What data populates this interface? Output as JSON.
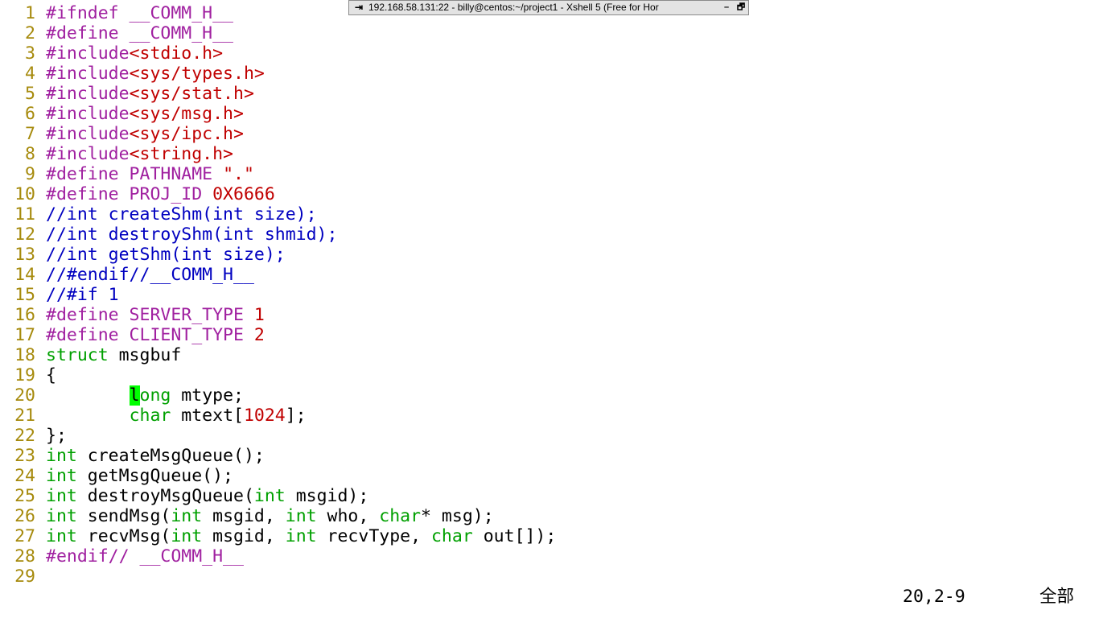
{
  "titlebar": {
    "text": "192.168.58.131:22 - billy@centos:~/project1 - Xshell 5 (Free for Hor",
    "pin_glyph": "⇥",
    "minimize_glyph": "–",
    "restore_glyph": "🗗"
  },
  "colors": {
    "background": "#ffffff",
    "line_number": "#a68a0c",
    "preproc": "#a020a0",
    "string": "#c00000",
    "number": "#c00000",
    "comment": "#0000c0",
    "type": "#00a000",
    "cursor_bg": "#00ff00",
    "normal": "#000000"
  },
  "editor": {
    "lines": [
      {
        "n": "1",
        "tokens": [
          {
            "t": "#ifndef __COMM_H__",
            "c": "preproc"
          }
        ]
      },
      {
        "n": "2",
        "tokens": [
          {
            "t": "#define __COMM_H__",
            "c": "preproc"
          }
        ]
      },
      {
        "n": "3",
        "tokens": [
          {
            "t": "#include",
            "c": "preproc"
          },
          {
            "t": "<stdio.h>",
            "c": "string"
          }
        ]
      },
      {
        "n": "4",
        "tokens": [
          {
            "t": "#include",
            "c": "preproc"
          },
          {
            "t": "<sys/types.h>",
            "c": "string"
          }
        ]
      },
      {
        "n": "5",
        "tokens": [
          {
            "t": "#include",
            "c": "preproc"
          },
          {
            "t": "<sys/stat.h>",
            "c": "string"
          }
        ]
      },
      {
        "n": "6",
        "tokens": [
          {
            "t": "#include",
            "c": "preproc"
          },
          {
            "t": "<sys/msg.h>",
            "c": "string"
          }
        ]
      },
      {
        "n": "7",
        "tokens": [
          {
            "t": "#include",
            "c": "preproc"
          },
          {
            "t": "<sys/ipc.h>",
            "c": "string"
          }
        ]
      },
      {
        "n": "8",
        "tokens": [
          {
            "t": "#include",
            "c": "preproc"
          },
          {
            "t": "<string.h>",
            "c": "string"
          }
        ]
      },
      {
        "n": "9",
        "tokens": [
          {
            "t": "#define PATHNAME ",
            "c": "preproc"
          },
          {
            "t": "\".\"",
            "c": "string"
          }
        ]
      },
      {
        "n": "10",
        "tokens": [
          {
            "t": "#define PROJ_ID ",
            "c": "preproc"
          },
          {
            "t": "0X6666",
            "c": "number"
          }
        ]
      },
      {
        "n": "11",
        "tokens": [
          {
            "t": "//int createShm(int size);",
            "c": "comment"
          }
        ]
      },
      {
        "n": "12",
        "tokens": [
          {
            "t": "//int destroyShm(int shmid);",
            "c": "comment"
          }
        ]
      },
      {
        "n": "13",
        "tokens": [
          {
            "t": "//int getShm(int size);",
            "c": "comment"
          }
        ]
      },
      {
        "n": "14",
        "tokens": [
          {
            "t": "//#endif//__COMM_H__",
            "c": "comment"
          }
        ]
      },
      {
        "n": "15",
        "tokens": [
          {
            "t": "//#if 1",
            "c": "comment"
          }
        ]
      },
      {
        "n": "16",
        "tokens": [
          {
            "t": "#define SERVER_TYPE ",
            "c": "preproc"
          },
          {
            "t": "1",
            "c": "number"
          }
        ]
      },
      {
        "n": "17",
        "tokens": [
          {
            "t": "#define CLIENT_TYPE ",
            "c": "preproc"
          },
          {
            "t": "2",
            "c": "number"
          }
        ]
      },
      {
        "n": "18",
        "tokens": [
          {
            "t": "struct",
            "c": "type"
          },
          {
            "t": " msgbuf",
            "c": "normal"
          }
        ]
      },
      {
        "n": "19",
        "tokens": [
          {
            "t": "{",
            "c": "normal"
          }
        ]
      },
      {
        "n": "20",
        "tokens": [
          {
            "t": "        ",
            "c": "normal"
          },
          {
            "t": "l",
            "c": "cursor"
          },
          {
            "t": "ong",
            "c": "type"
          },
          {
            "t": " mtype;",
            "c": "normal"
          }
        ]
      },
      {
        "n": "21",
        "tokens": [
          {
            "t": "        ",
            "c": "normal"
          },
          {
            "t": "char",
            "c": "type"
          },
          {
            "t": " mtext[",
            "c": "normal"
          },
          {
            "t": "1024",
            "c": "number"
          },
          {
            "t": "];",
            "c": "normal"
          }
        ]
      },
      {
        "n": "22",
        "tokens": [
          {
            "t": "};",
            "c": "normal"
          }
        ]
      },
      {
        "n": "23",
        "tokens": [
          {
            "t": "int",
            "c": "type"
          },
          {
            "t": " createMsgQueue();",
            "c": "normal"
          }
        ]
      },
      {
        "n": "24",
        "tokens": [
          {
            "t": "int",
            "c": "type"
          },
          {
            "t": " getMsgQueue();",
            "c": "normal"
          }
        ]
      },
      {
        "n": "25",
        "tokens": [
          {
            "t": "int",
            "c": "type"
          },
          {
            "t": " destroyMsgQueue(",
            "c": "normal"
          },
          {
            "t": "int",
            "c": "type"
          },
          {
            "t": " msgid);",
            "c": "normal"
          }
        ]
      },
      {
        "n": "26",
        "tokens": [
          {
            "t": "int",
            "c": "type"
          },
          {
            "t": " sendMsg(",
            "c": "normal"
          },
          {
            "t": "int",
            "c": "type"
          },
          {
            "t": " msgid, ",
            "c": "normal"
          },
          {
            "t": "int",
            "c": "type"
          },
          {
            "t": " who, ",
            "c": "normal"
          },
          {
            "t": "char",
            "c": "type"
          },
          {
            "t": "* msg);",
            "c": "normal"
          }
        ]
      },
      {
        "n": "27",
        "tokens": [
          {
            "t": "int",
            "c": "type"
          },
          {
            "t": " recvMsg(",
            "c": "normal"
          },
          {
            "t": "int",
            "c": "type"
          },
          {
            "t": " msgid, ",
            "c": "normal"
          },
          {
            "t": "int",
            "c": "type"
          },
          {
            "t": " recvType, ",
            "c": "normal"
          },
          {
            "t": "char",
            "c": "type"
          },
          {
            "t": " out[]);",
            "c": "normal"
          }
        ]
      },
      {
        "n": "28",
        "tokens": [
          {
            "t": "#endif// __COMM_H__",
            "c": "preproc"
          }
        ]
      },
      {
        "n": "29",
        "tokens": []
      }
    ]
  },
  "statusline": {
    "cursor_position": "20,2-9",
    "scroll_position": "全部"
  }
}
